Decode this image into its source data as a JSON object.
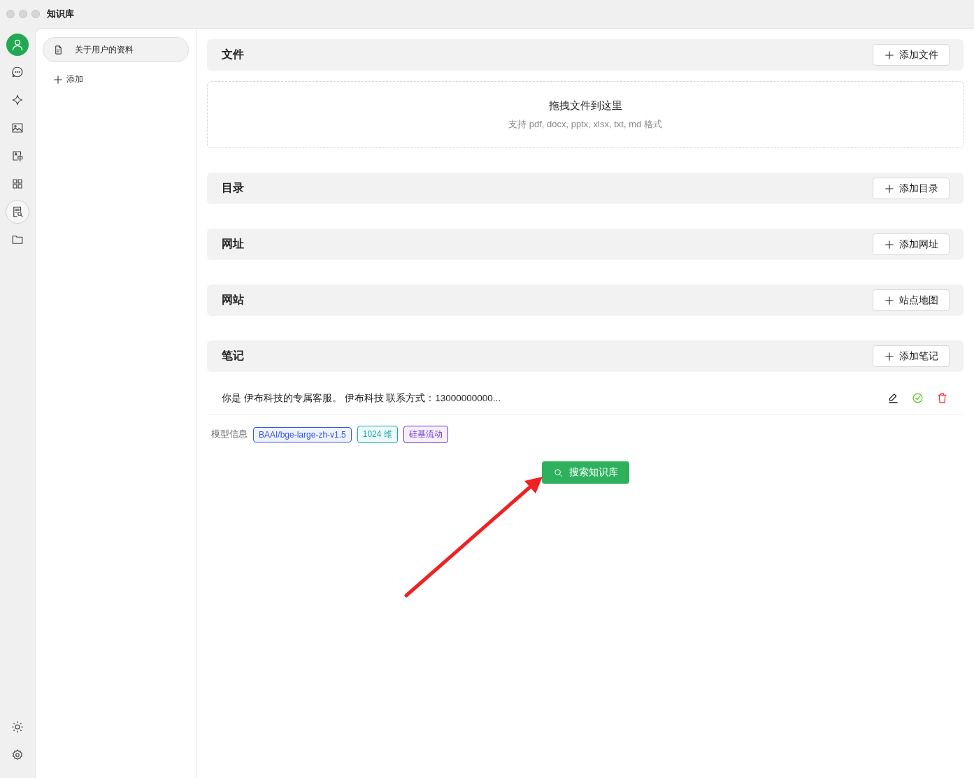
{
  "window": {
    "title": "知识库"
  },
  "nav": {
    "items": [
      {
        "kind": "avatar",
        "selected": false
      },
      {
        "kind": "chat",
        "selected": false
      },
      {
        "kind": "sparkle",
        "selected": false
      },
      {
        "kind": "image",
        "selected": false
      },
      {
        "kind": "translate",
        "selected": false
      },
      {
        "kind": "apps",
        "selected": false
      },
      {
        "kind": "knowledge",
        "selected": true
      },
      {
        "kind": "folder",
        "selected": false
      }
    ],
    "bottom": [
      {
        "kind": "theme"
      },
      {
        "kind": "settings"
      }
    ]
  },
  "sidebar": {
    "items": [
      {
        "label": "关于用户的资料",
        "selected": true
      }
    ],
    "add_label": "添加"
  },
  "sections": [
    {
      "title": "文件",
      "button": "添加文件",
      "kind": "dropzone",
      "drop_title": "拖拽文件到这里",
      "drop_hint": "支持 pdf, docx, pptx, xlsx, txt, md 格式"
    },
    {
      "title": "目录",
      "button": "添加目录",
      "kind": "plain"
    },
    {
      "title": "网址",
      "button": "添加网址",
      "kind": "plain"
    },
    {
      "title": "网站",
      "button": "站点地图",
      "kind": "plain"
    },
    {
      "title": "笔记",
      "button": "添加笔记",
      "kind": "notes",
      "notes": [
        {
          "text": "你是 伊布科技的专属客服。 伊布科技 联系方式：13000000000..."
        }
      ]
    }
  ],
  "model_info": {
    "label": "模型信息",
    "tags": [
      {
        "text": "BAAI/bge-large-zh-v1.5",
        "color": "#2f54eb"
      },
      {
        "text": "1024 维",
        "color": "#13a8a8"
      },
      {
        "text": "硅基流动",
        "color": "#722ed1"
      }
    ]
  },
  "search_button": "搜索知识库"
}
